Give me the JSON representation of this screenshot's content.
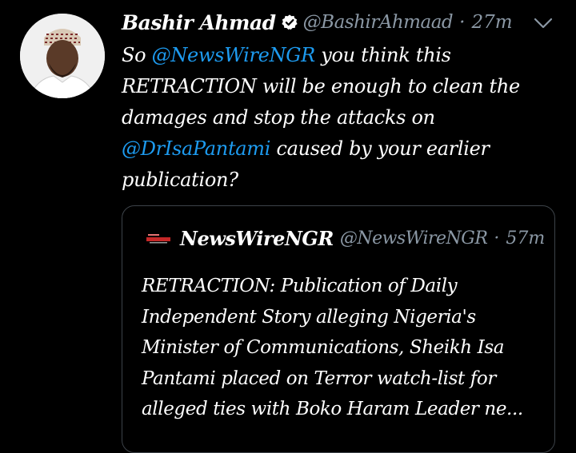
{
  "tweet": {
    "display_name": "Bashir Ahmad",
    "handle": "@BashirAhmaad",
    "separator": "·",
    "time": "27m",
    "verified": true,
    "avatar_icon": "profile-photo",
    "menu_icon": "chevron-down-icon",
    "text": {
      "part1": "So ",
      "mention1": "@NewsWireNGR",
      "part2": " you think this RETRACTION will be enough to clean the damages and stop the attacks on ",
      "mention2": "@DrIsaPantami",
      "part3": " caused by your earlier publication?"
    }
  },
  "quoted_tweet": {
    "display_name": "NewsWireNGR",
    "handle": "@NewsWireNGR",
    "separator": "·",
    "time": "57m",
    "avatar_icon": "newswire-logo",
    "text": "RETRACTION: Publication of Daily Independent Story alleging Nigeria's Minister of Communications, Sheikh Isa Pantami placed on Terror watch-list for alleged ties with Boko Haram Leader ne..."
  },
  "colors": {
    "background": "#000000",
    "text": "#ffffff",
    "muted": "#8b98a5",
    "link": "#1d9bf0",
    "border": "#3d4349",
    "verified": "#ffffff"
  }
}
